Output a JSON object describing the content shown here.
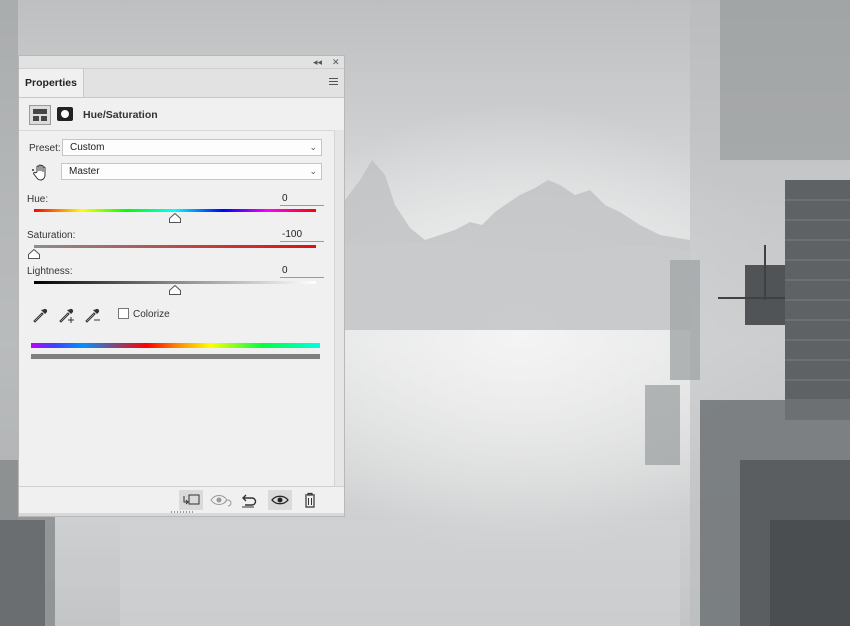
{
  "panel": {
    "tab_label": "Properties",
    "collapse_glyph": "◂◂",
    "close_glyph": "✕",
    "menu_icon": "hamburger-menu-icon"
  },
  "adjustment": {
    "title": "Hue/Saturation",
    "preset_label": "Preset:",
    "preset_value": "Custom",
    "channel_value": "Master"
  },
  "sliders": {
    "hue": {
      "label": "Hue:",
      "value": "0",
      "level": 0.5
    },
    "saturation": {
      "label": "Saturation:",
      "value": "-100",
      "level": 0.0
    },
    "lightness": {
      "label": "Lightness:",
      "value": "0",
      "level": 0.5
    }
  },
  "colorize": {
    "label": "Colorize",
    "checked": false
  },
  "footer_icons": [
    "clip-to-layer-icon",
    "view-previous-icon",
    "reset-icon",
    "visibility-eye-icon",
    "delete-trash-icon"
  ],
  "colors": {
    "panel_bg": "#f0f0f0",
    "accent_track_red": "#e01010"
  }
}
